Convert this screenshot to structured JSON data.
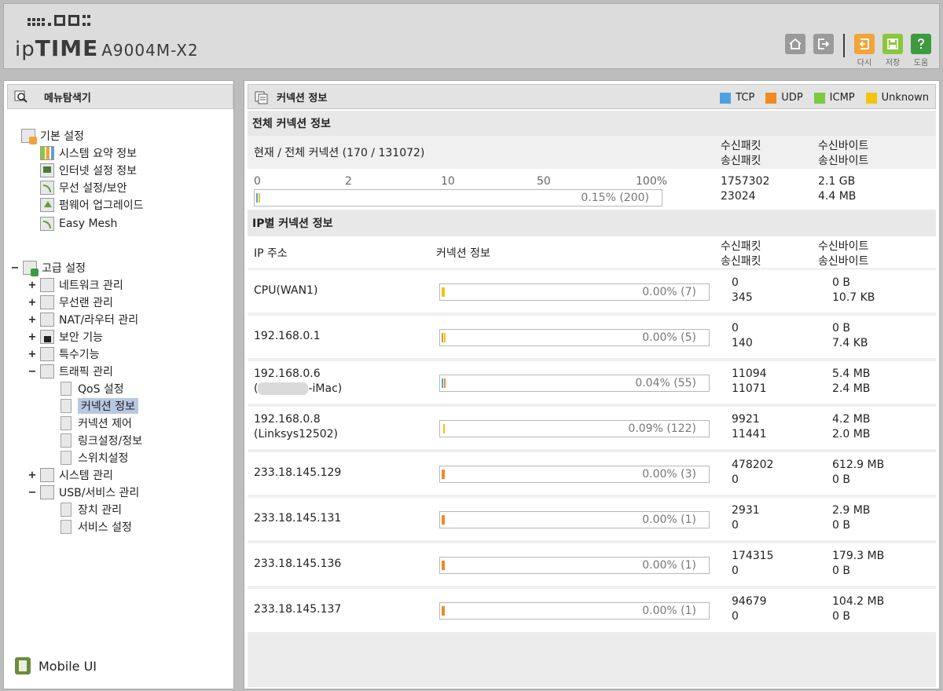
{
  "header": {
    "brand_ip": "ip",
    "brand_time": "TIME",
    "model": "A9004M-X2",
    "buttons": {
      "redo": "다시",
      "save": "저장",
      "help": "도움"
    }
  },
  "sidebar": {
    "title": "메뉴탐색기",
    "basic": {
      "label": "기본 설정",
      "items": [
        "시스템 요약 정보",
        "인터넷 설정 정보",
        "무선 설정/보안",
        "펌웨어 업그레이드",
        "Easy Mesh"
      ]
    },
    "advanced": {
      "label": "고급 설정",
      "items": [
        "네트워크 관리",
        "무선랜 관리",
        "NAT/라우터 관리",
        "보안 기능",
        "특수기능",
        "트래픽 관리",
        "시스템 관리",
        "USB/서비스 관리"
      ],
      "traffic_items": [
        "QoS 설정",
        "커넥션 정보",
        "커넥션 제어",
        "링크설정/정보",
        "스위치설정"
      ],
      "usb_items": [
        "장치 관리",
        "서비스 설정"
      ]
    },
    "mobile": "Mobile UI"
  },
  "main": {
    "title": "커넥션 정보",
    "legend": [
      {
        "label": "TCP",
        "color": "#4aa3df"
      },
      {
        "label": "UDP",
        "color": "#f08a24"
      },
      {
        "label": "ICMP",
        "color": "#7ac943"
      },
      {
        "label": "Unknown",
        "color": "#f2c40f"
      }
    ],
    "total_section": "전체 커넥션 정보",
    "total_header": "현재 / 전체 커넥션 (170 / 131072)",
    "col_packets": [
      "수신패킷",
      "송신패킷"
    ],
    "col_bytes": [
      "수신바이트",
      "송신바이트"
    ],
    "scale": [
      "0",
      "2",
      "10",
      "50",
      "100%"
    ],
    "total": {
      "pct": "0.15% (200)",
      "rx_packets": "1757302",
      "tx_packets": "23024",
      "rx_bytes": "2.1 GB",
      "tx_bytes": "4.4 MB"
    },
    "ip_section": "IP별 커넥션 정보",
    "col_ip": "IP 주소",
    "col_conn": "커넥션 정보",
    "rows": [
      {
        "ip": "CPU(WAN1)",
        "sub": "",
        "pct": "0.00% (7)",
        "rx_p": "0",
        "tx_p": "345",
        "rx_b": "0 B",
        "tx_b": "10.7 KB",
        "color": "#f2c40f"
      },
      {
        "ip": "192.168.0.1",
        "sub": "",
        "pct": "0.00% (5)",
        "rx_p": "0",
        "tx_p": "140",
        "rx_b": "0 B",
        "tx_b": "7.4 KB",
        "color": "#f08a24"
      },
      {
        "ip": "192.168.0.6",
        "sub": "-iMac)",
        "pct": "0.04% (55)",
        "rx_p": "11094",
        "tx_p": "11071",
        "rx_b": "5.4 MB",
        "tx_b": "2.4 MB",
        "color": "#4aa3df"
      },
      {
        "ip": "192.168.0.8",
        "sub": "(Linksys12502)",
        "pct": "0.09% (122)",
        "rx_p": "9921",
        "tx_p": "11441",
        "rx_b": "4.2 MB",
        "tx_b": "2.0 MB",
        "color": "#f2c40f"
      },
      {
        "ip": "233.18.145.129",
        "sub": "",
        "pct": "0.00% (3)",
        "rx_p": "478202",
        "tx_p": "0",
        "rx_b": "612.9 MB",
        "tx_b": "0 B",
        "color": "#f08a24"
      },
      {
        "ip": "233.18.145.131",
        "sub": "",
        "pct": "0.00% (1)",
        "rx_p": "2931",
        "tx_p": "0",
        "rx_b": "2.9 MB",
        "tx_b": "0 B",
        "color": "#f08a24"
      },
      {
        "ip": "233.18.145.136",
        "sub": "",
        "pct": "0.00% (1)",
        "rx_p": "174315",
        "tx_p": "0",
        "rx_b": "179.3 MB",
        "tx_b": "0 B",
        "color": "#f08a24"
      },
      {
        "ip": "233.18.145.137",
        "sub": "",
        "pct": "0.00% (1)",
        "rx_p": "94679",
        "tx_p": "0",
        "rx_b": "104.2 MB",
        "tx_b": "0 B",
        "color": "#f08a24"
      }
    ]
  }
}
